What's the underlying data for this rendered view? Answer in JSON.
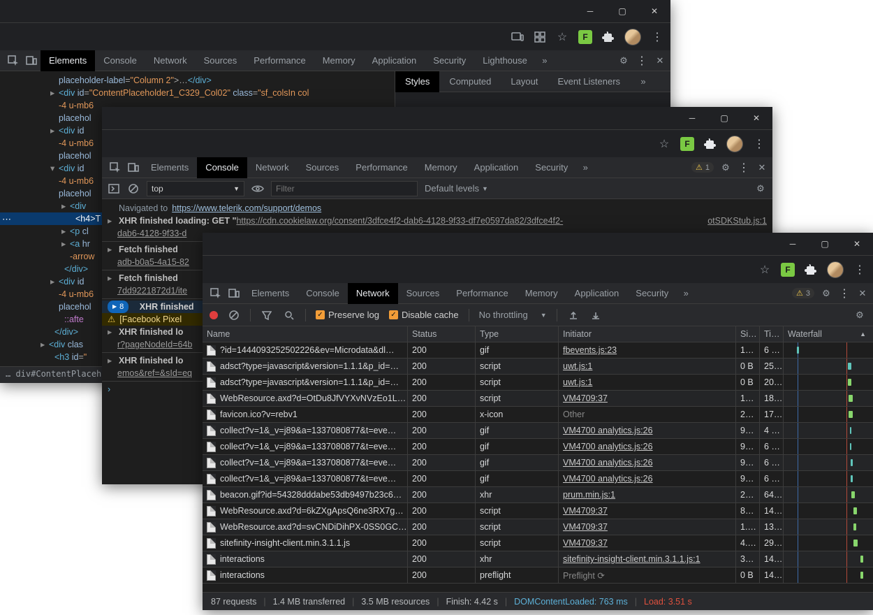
{
  "tabs": {
    "elements": "Elements",
    "console": "Console",
    "network": "Network",
    "sources": "Sources",
    "performance": "Performance",
    "memory": "Memory",
    "application": "Application",
    "security": "Security",
    "lighthouse": "Lighthouse"
  },
  "w1": {
    "subtabs": {
      "styles": "Styles",
      "computed": "Computed",
      "layout": "Layout",
      "listeners": "Event Listeners"
    },
    "crumb": "… div#ContentPlaceho…",
    "dots": "⋯"
  },
  "consoleBar": {
    "top": "top",
    "filter": "Filter",
    "levels": "Default levels"
  },
  "cons": {
    "nav_label": "Navigated to ",
    "nav_url": "https://www.telerik.com/support/demos",
    "xhr1_a": "XHR finished loading: GET \"",
    "xhr1_b": "https://cdn.cookielaw.org/consent/3dfce4f2-dab6-4128-9f33-df7e0597da82/3dfce4f2-",
    "xhr1_src": "otSDKStub.js:1",
    "xhr1_sub": "dab6-4128-9f33-d",
    "fetch1": "Fetch finished",
    "fetch1_sub": "adb-b0a5-4a15-82",
    "fetch2": "Fetch finished",
    "fetch2_sub": "7dd9221872d1/ite",
    "pill": "8",
    "pill_txt": "XHR finished",
    "warn": "[Facebook Pixel",
    "xhrf1": "XHR finished lo",
    "xhrf1_sub": "r?pageNodeId=64b",
    "xhrf2": "XHR finished lo",
    "xhrf2_sub": "emos&ref=&sId=eq"
  },
  "w2_warn": "1",
  "w3_warn": "3",
  "netbar": {
    "preserve": "Preserve log",
    "disable": "Disable cache",
    "throttle": "No throttling"
  },
  "netcols": {
    "name": "Name",
    "status": "Status",
    "type": "Type",
    "initiator": "Initiator",
    "size": "Si…",
    "time": "Ti…",
    "wf": "Waterfall"
  },
  "netrows": [
    {
      "name": "?id=1444093252502226&ev=Microdata&dl…",
      "status": "200",
      "type": "gif",
      "init": "fbevents.js:23",
      "ilink": true,
      "size": "1…",
      "time": "6 …",
      "wf": {
        "l": 15,
        "w": 2,
        "c": "#60c5ba"
      }
    },
    {
      "name": "adsct?type=javascript&version=1.1.1&p_id=…",
      "status": "200",
      "type": "script",
      "init": "uwt.js:1",
      "ilink": true,
      "size": "0 B",
      "time": "25…",
      "wf": {
        "l": 72,
        "w": 4,
        "c": "#60c5ba"
      }
    },
    {
      "name": "adsct?type=javascript&version=1.1.1&p_id=…",
      "status": "200",
      "type": "script",
      "init": "uwt.js:1",
      "ilink": true,
      "size": "0 B",
      "time": "20…",
      "wf": {
        "l": 72,
        "w": 4,
        "c": "#88d66c"
      }
    },
    {
      "name": "WebResource.axd?d=OtDu8JfVYXvNVzEo1L…",
      "status": "200",
      "type": "script",
      "init": "VM4709:37",
      "ilink": true,
      "size": "1…",
      "time": "18…",
      "wf": {
        "l": 73,
        "w": 4,
        "c": "#88d66c"
      }
    },
    {
      "name": "favicon.ico?v=rebv1",
      "status": "200",
      "type": "x-icon",
      "init": "Other",
      "ilink": false,
      "size": "2…",
      "time": "17…",
      "wf": {
        "l": 73,
        "w": 4,
        "c": "#88d66c"
      }
    },
    {
      "name": "collect?v=1&_v=j89&a=1337080877&t=eve…",
      "status": "200",
      "type": "gif",
      "init": "VM4700 analytics.js:26",
      "ilink": true,
      "size": "9…",
      "time": "4 …",
      "wf": {
        "l": 74,
        "w": 2,
        "c": "#60c5ba"
      }
    },
    {
      "name": "collect?v=1&_v=j89&a=1337080877&t=eve…",
      "status": "200",
      "type": "gif",
      "init": "VM4700 analytics.js:26",
      "ilink": true,
      "size": "9…",
      "time": "6 …",
      "wf": {
        "l": 74,
        "w": 2,
        "c": "#60c5ba"
      }
    },
    {
      "name": "collect?v=1&_v=j89&a=1337080877&t=eve…",
      "status": "200",
      "type": "gif",
      "init": "VM4700 analytics.js:26",
      "ilink": true,
      "size": "9…",
      "time": "6 …",
      "wf": {
        "l": 75,
        "w": 2,
        "c": "#60c5ba"
      }
    },
    {
      "name": "collect?v=1&_v=j89&a=1337080877&t=eve…",
      "status": "200",
      "type": "gif",
      "init": "VM4700 analytics.js:26",
      "ilink": true,
      "size": "9…",
      "time": "6 …",
      "wf": {
        "l": 75,
        "w": 2,
        "c": "#60c5ba"
      }
    },
    {
      "name": "beacon.gif?id=54328dddabe53db9497b23c6…",
      "status": "200",
      "type": "xhr",
      "init": "prum.min.js:1",
      "ilink": true,
      "size": "2…",
      "time": "64…",
      "wf": {
        "l": 76,
        "w": 4,
        "c": "#88d66c"
      }
    },
    {
      "name": "WebResource.axd?d=6kZXgApsQ6ne3RX7g…",
      "status": "200",
      "type": "script",
      "init": "VM4709:37",
      "ilink": true,
      "size": "8…",
      "time": "14…",
      "wf": {
        "l": 78,
        "w": 4,
        "c": "#88d66c"
      }
    },
    {
      "name": "WebResource.axd?d=svCNDiDihPX-0SS0GC…",
      "status": "200",
      "type": "script",
      "init": "VM4709:37",
      "ilink": true,
      "size": "1.…",
      "time": "13…",
      "wf": {
        "l": 78,
        "w": 3,
        "c": "#88d66c"
      }
    },
    {
      "name": "sitefinity-insight-client.min.3.1.1.js",
      "status": "200",
      "type": "script",
      "init": "VM4709:37",
      "ilink": true,
      "size": "4.…",
      "time": "29…",
      "wf": {
        "l": 78,
        "w": 5,
        "c": "#88d66c"
      }
    },
    {
      "name": "interactions",
      "status": "200",
      "type": "xhr",
      "init": "sitefinity-insight-client.min.3.1.1.js:1",
      "ilink": true,
      "size": "3…",
      "time": "14…",
      "wf": {
        "l": 86,
        "w": 3,
        "c": "#88d66c"
      }
    },
    {
      "name": "interactions",
      "status": "200",
      "type": "preflight",
      "init": "Preflight ⟳",
      "ilink": false,
      "size": "0 B",
      "time": "14…",
      "wf": {
        "l": 86,
        "w": 3,
        "c": "#88d66c"
      }
    }
  ],
  "netstat": {
    "req": "87 requests",
    "tx": "1.4 MB transferred",
    "res": "3.5 MB resources",
    "fin": "Finish: 4.42 s",
    "dcl": "DOMContentLoaded: 763 ms",
    "load": "Load: 3.51 s"
  }
}
